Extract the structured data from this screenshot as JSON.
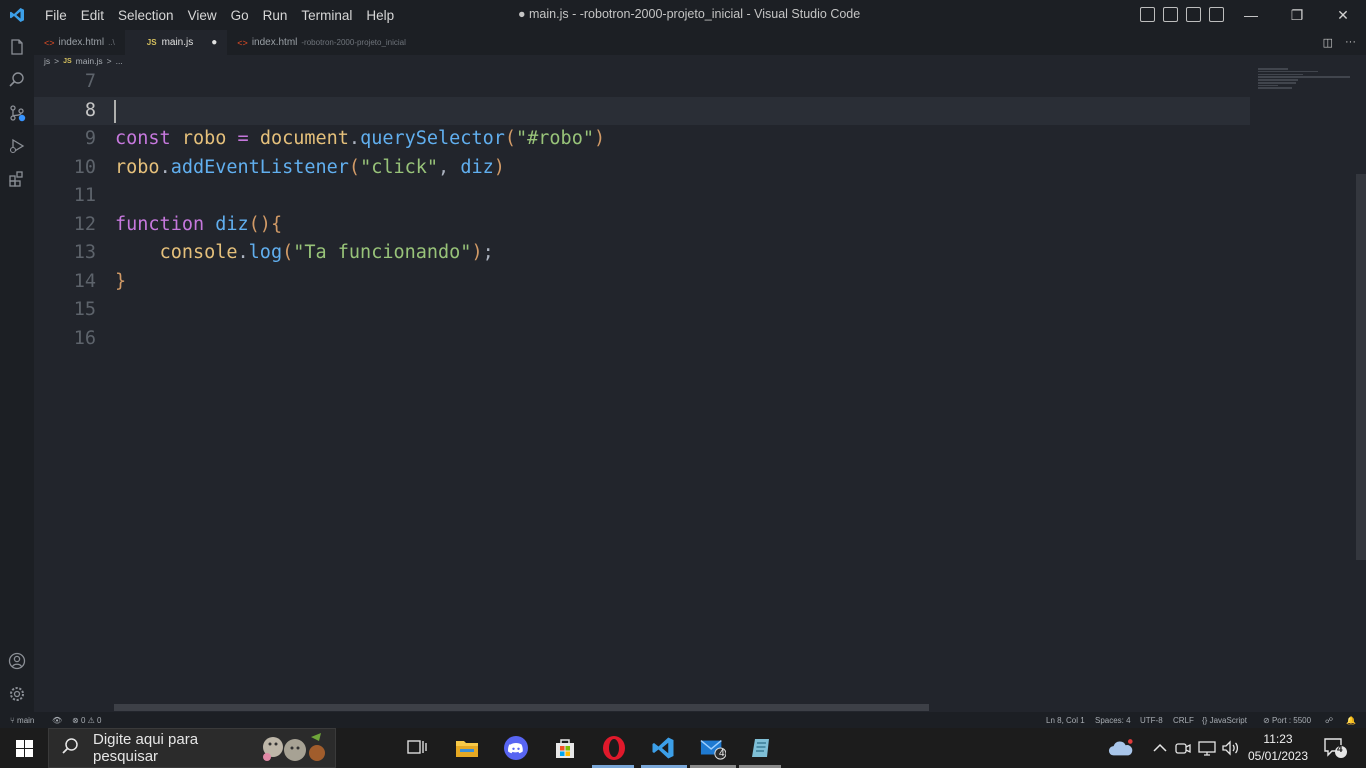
{
  "window": {
    "title": "● main.js - -robotron-2000-projeto_inicial - Visual Studio Code",
    "minimize": "—",
    "maximize": "❐",
    "close": "✕"
  },
  "menu": [
    "File",
    "Edit",
    "Selection",
    "View",
    "Go",
    "Run",
    "Terminal",
    "Help"
  ],
  "tabs": [
    {
      "icon": "html-icon",
      "label": "index.html",
      "path": "..\\"
    },
    {
      "icon": "js-icon",
      "label": "main.js",
      "badge": "●"
    },
    {
      "icon": "html-icon",
      "label": "index.html",
      "path": "-robotron-2000-projeto_inicial"
    }
  ],
  "tab_actions": [
    "◫",
    "···"
  ],
  "breadcrumb": {
    "folder": "js",
    "sep": ">",
    "file_icon": "JS",
    "file": "main.js",
    "more": "..."
  },
  "editor": {
    "lines": [
      {
        "n": "7",
        "tokens": []
      },
      {
        "n": "8",
        "tokens": [],
        "current": true
      },
      {
        "n": "9",
        "tokens": [
          [
            "kw",
            "const "
          ],
          [
            "var",
            "robo"
          ],
          [
            "plain",
            " "
          ],
          [
            "op",
            "="
          ],
          [
            "plain",
            " "
          ],
          [
            "var",
            "document"
          ],
          [
            "punc",
            "."
          ],
          [
            "fn",
            "querySelector"
          ],
          [
            "paren",
            "("
          ],
          [
            "str",
            "\"#robo\""
          ],
          [
            "paren",
            ")"
          ]
        ]
      },
      {
        "n": "10",
        "tokens": [
          [
            "var",
            "robo"
          ],
          [
            "punc",
            "."
          ],
          [
            "fn",
            "addEventListener"
          ],
          [
            "paren",
            "("
          ],
          [
            "str",
            "\"click\""
          ],
          [
            "punc",
            ", "
          ],
          [
            "fn",
            "diz"
          ],
          [
            "paren",
            ")"
          ]
        ]
      },
      {
        "n": "11",
        "tokens": []
      },
      {
        "n": "12",
        "tokens": [
          [
            "kw",
            "function "
          ],
          [
            "fn",
            "diz"
          ],
          [
            "paren",
            "(){"
          ]
        ]
      },
      {
        "n": "13",
        "tokens": [
          [
            "plain",
            "    "
          ],
          [
            "var",
            "console"
          ],
          [
            "punc",
            "."
          ],
          [
            "fn",
            "log"
          ],
          [
            "paren",
            "("
          ],
          [
            "str",
            "\"Ta funcionando\""
          ],
          [
            "paren",
            ")"
          ],
          [
            "punc",
            ";"
          ]
        ]
      },
      {
        "n": "14",
        "tokens": [
          [
            "paren",
            "}"
          ]
        ]
      },
      {
        "n": "15",
        "tokens": []
      },
      {
        "n": "16",
        "tokens": []
      }
    ]
  },
  "status": {
    "branch": "main",
    "errors": "0",
    "warnings": "0",
    "position": "Ln 8, Col 1",
    "spaces": "Spaces: 4",
    "encoding": "UTF-8",
    "eol": "CRLF",
    "language": "JavaScript",
    "port": "Port : 5500"
  },
  "taskbar": {
    "search_placeholder": "Digite aqui para pesquisar",
    "time": "11:23",
    "date": "05/01/2023",
    "notif_count": "4",
    "mail_badge": "4"
  }
}
